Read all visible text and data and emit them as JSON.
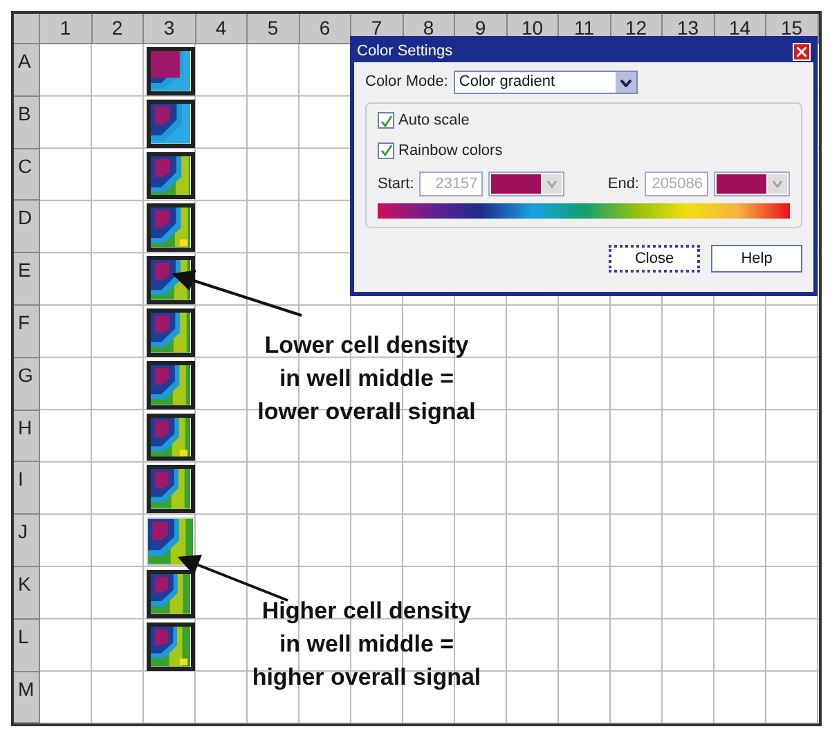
{
  "plate": {
    "column_headers": [
      "1",
      "2",
      "3",
      "4",
      "5",
      "6",
      "7",
      "8",
      "9",
      "10",
      "11",
      "12",
      "13",
      "14",
      "15"
    ],
    "rows": [
      {
        "label": "A",
        "well": {
          "kind": "heatmap",
          "outlined": true
        }
      },
      {
        "label": "B",
        "well": {
          "kind": "heatmap",
          "outlined": true
        }
      },
      {
        "label": "C",
        "well": {
          "kind": "heatmap",
          "outlined": true
        }
      },
      {
        "label": "D",
        "well": {
          "kind": "heatmap",
          "outlined": true
        }
      },
      {
        "label": "E",
        "well": {
          "kind": "heatmap",
          "outlined": true
        }
      },
      {
        "label": "F",
        "well": {
          "kind": "heatmap",
          "outlined": true
        }
      },
      {
        "label": "G",
        "well": {
          "kind": "heatmap",
          "outlined": true
        }
      },
      {
        "label": "H",
        "well": {
          "kind": "heatmap",
          "outlined": true
        }
      },
      {
        "label": "I",
        "well": {
          "kind": "heatmap",
          "outlined": true
        }
      },
      {
        "label": "J",
        "well": {
          "kind": "heatmap",
          "outlined": false
        }
      },
      {
        "label": "K",
        "well": {
          "kind": "heatmap",
          "outlined": true
        }
      },
      {
        "label": "L",
        "well": {
          "kind": "heatmap",
          "outlined": true
        }
      },
      {
        "label": "M"
      }
    ]
  },
  "dialog": {
    "title": "Color Settings",
    "color_mode": {
      "label": "Color Mode:",
      "value": "Color gradient"
    },
    "checkboxes": [
      {
        "label": "Auto scale",
        "checked": true
      },
      {
        "label": "Rainbow colors",
        "checked": true
      }
    ],
    "range": [
      {
        "label": "Start:",
        "value": "23157",
        "disabled": true,
        "color": "#a0105a"
      },
      {
        "label": "End:",
        "value": "205086",
        "disabled": true,
        "color": "#a0105a"
      }
    ],
    "buttons": [
      {
        "label": "Close",
        "focused": true
      },
      {
        "label": "Help",
        "focused": false
      }
    ]
  },
  "annotations": [
    {
      "text": "Lower cell density\nin well middle =\nlower overall signal"
    },
    {
      "text": "Higher cell density\nin well middle =\nhigher overall signal"
    }
  ]
}
